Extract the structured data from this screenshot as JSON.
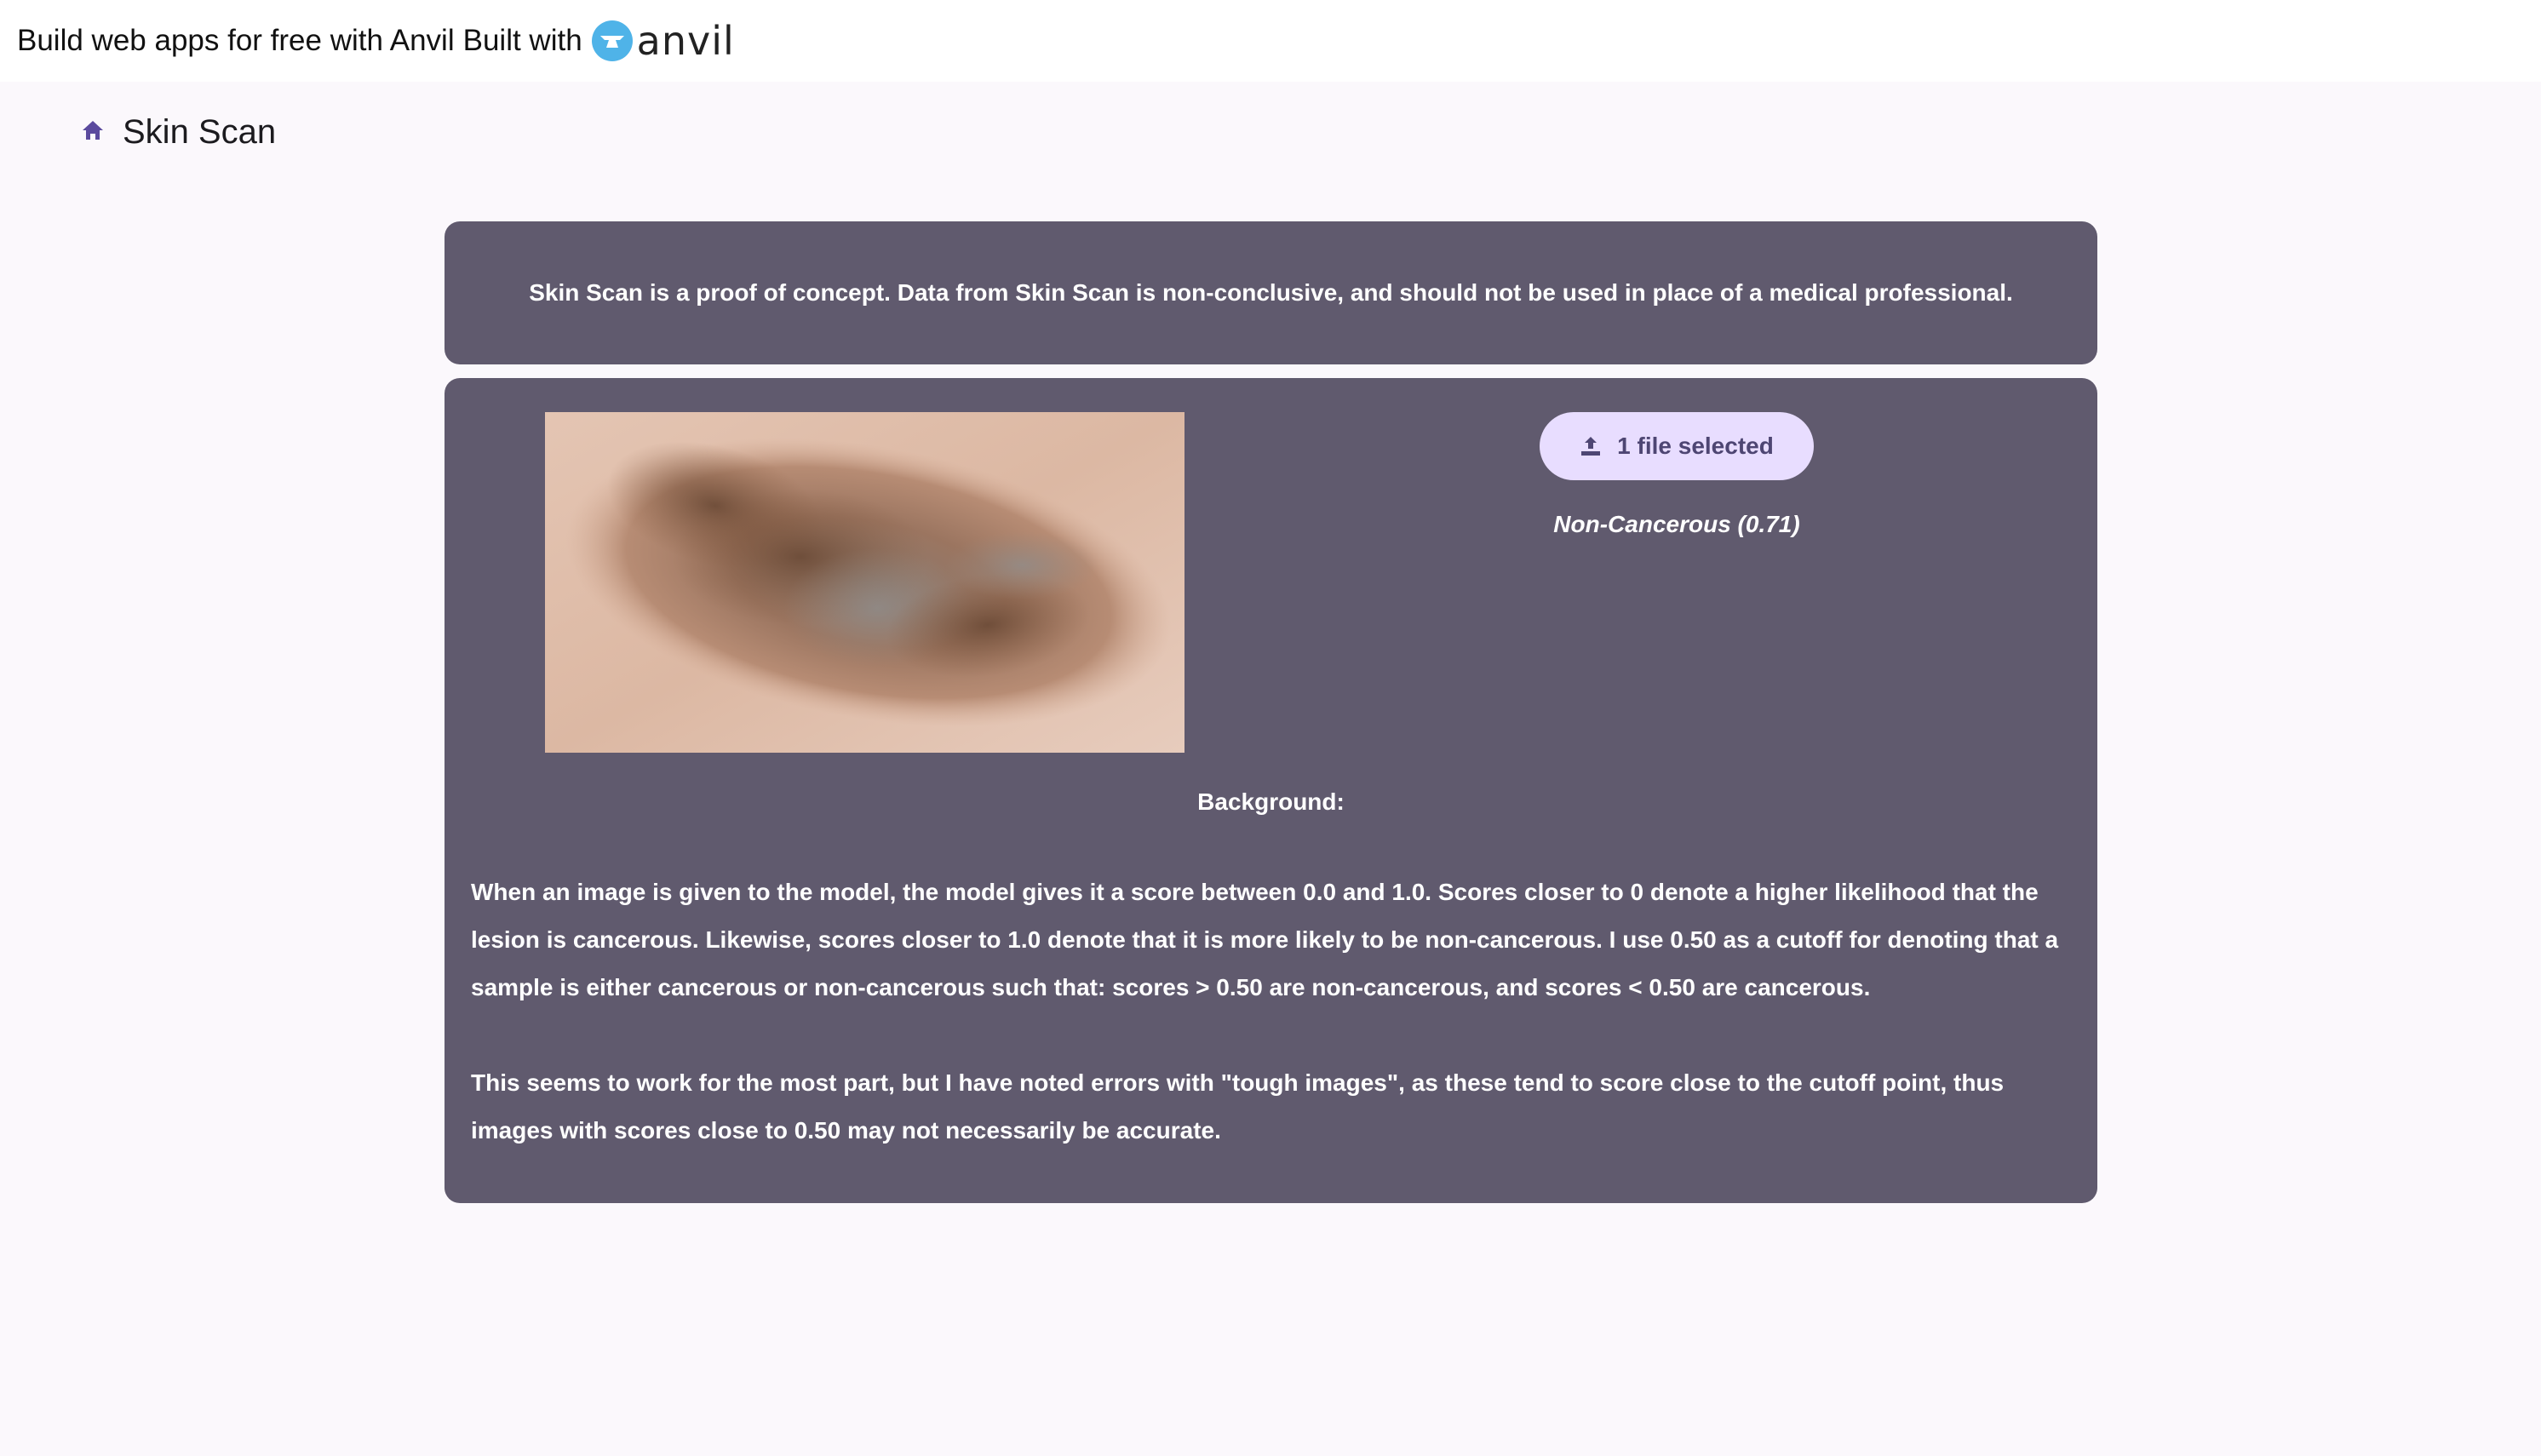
{
  "banner": {
    "build_text": "Build web apps for free with Anvil",
    "built_with": "Built with",
    "logo_text": "anvil",
    "logo_color": "#4fb3e8"
  },
  "header": {
    "home_icon": "home-icon",
    "title": "Skin Scan"
  },
  "notice": {
    "text": "Skin Scan is a proof of concept. Data from Skin Scan is non-conclusive, and should not be used in place of a medical professional."
  },
  "main": {
    "upload": {
      "icon": "upload-icon",
      "label": "1 file selected"
    },
    "result": "Non-Cancerous (0.71)",
    "background_heading": "Background:",
    "paragraph1": "When an image is given to the model, the model gives it a score between 0.0 and 1.0. Scores closer to 0 denote a higher likelihood that the lesion is cancerous. Likewise, scores closer to 1.0 denote that it is more likely to be non-cancerous. I use 0.50 as a cutoff for denoting that a sample is either cancerous or non-cancerous such that: scores > 0.50 are non-cancerous, and scores < 0.50 are cancerous.",
    "paragraph2": "This seems to work for the most part, but I have noted errors with \"tough images\", as these tend to score close to the cutoff point, thus images with scores close to 0.50 may not necessarily be accurate."
  },
  "colors": {
    "card": "#605a6e",
    "upload_bg": "#e8ddff",
    "upload_text": "#4e4673",
    "page_bg": "#fbf8fc",
    "accent": "#5b4a9e"
  }
}
